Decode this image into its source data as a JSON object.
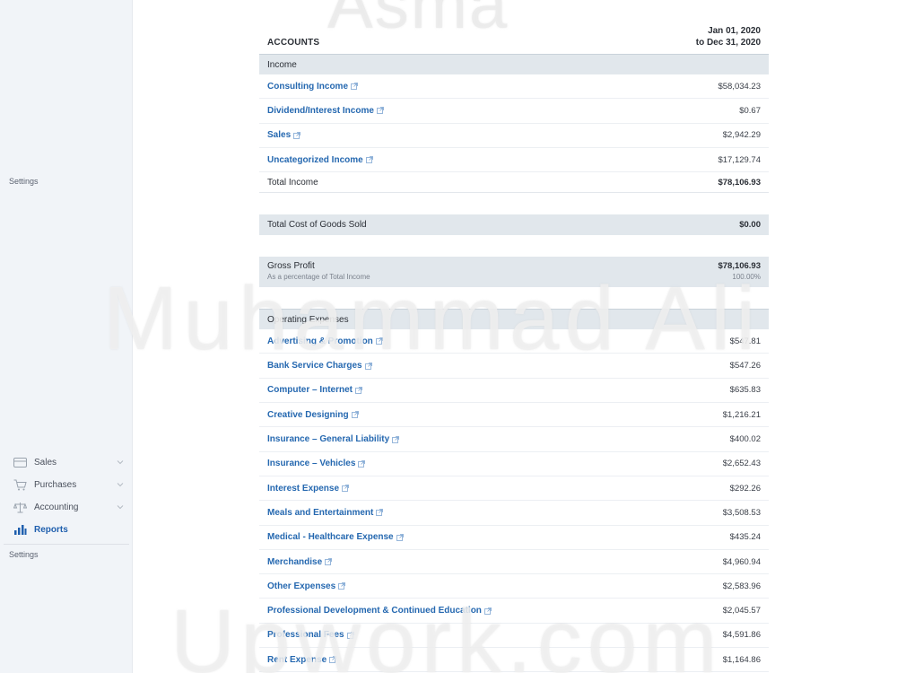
{
  "sidebar": {
    "settings_top": "Settings",
    "items": [
      {
        "label": "Sales",
        "icon": "card-icon"
      },
      {
        "label": "Purchases",
        "icon": "cart-icon"
      },
      {
        "label": "Accounting",
        "icon": "scale-icon"
      },
      {
        "label": "Reports",
        "icon": "bar-chart-icon"
      }
    ],
    "settings_bottom": "Settings"
  },
  "report": {
    "accounts_label": "ACCOUNTS",
    "period_line1": "Jan 01, 2020",
    "period_line2": "to Dec 31, 2020",
    "income": {
      "title": "Income",
      "rows": [
        {
          "name": "Consulting Income",
          "amount": "$58,034.23"
        },
        {
          "name": "Dividend/Interest Income",
          "amount": "$0.67"
        },
        {
          "name": "Sales",
          "amount": "$2,942.29"
        },
        {
          "name": "Uncategorized Income",
          "amount": "$17,129.74"
        }
      ],
      "total_label": "Total Income",
      "total_amount": "$78,106.93"
    },
    "cogs": {
      "label": "Total Cost of Goods Sold",
      "amount": "$0.00"
    },
    "gross_profit": {
      "label": "Gross Profit",
      "sub_label": "As a percentage of Total Income",
      "amount": "$78,106.93",
      "percent": "100.00%"
    },
    "expenses": {
      "title": "Operating Expenses",
      "rows": [
        {
          "name": "Advertising & Promotion",
          "amount": "$547.81"
        },
        {
          "name": "Bank Service Charges",
          "amount": "$547.26"
        },
        {
          "name": "Computer – Internet",
          "amount": "$635.83"
        },
        {
          "name": "Creative Designing",
          "amount": "$1,216.21"
        },
        {
          "name": "Insurance – General Liability",
          "amount": "$400.02"
        },
        {
          "name": "Insurance – Vehicles",
          "amount": "$2,652.43"
        },
        {
          "name": "Interest Expense",
          "amount": "$292.26"
        },
        {
          "name": "Meals and Entertainment",
          "amount": "$3,508.53"
        },
        {
          "name": "Medical - Healthcare Expense",
          "amount": "$435.24"
        },
        {
          "name": "Merchandise",
          "amount": "$4,960.94"
        },
        {
          "name": "Other Expenses",
          "amount": "$2,583.96"
        },
        {
          "name": "Professional Development & Continued Education",
          "amount": "$2,045.57"
        },
        {
          "name": "Professional Fees",
          "amount": "$4,591.86"
        },
        {
          "name": "Rent Expense",
          "amount": "$1,164.86"
        }
      ]
    }
  },
  "watermarks": {
    "top": "Asma",
    "middle": "Muhammad Ali",
    "bottom": "Upwork.com"
  },
  "colors": {
    "link": "#2568b0",
    "band": "#e1e7ec",
    "sidebar_bg": "#f1f4f8",
    "active": "#1f5fae"
  }
}
